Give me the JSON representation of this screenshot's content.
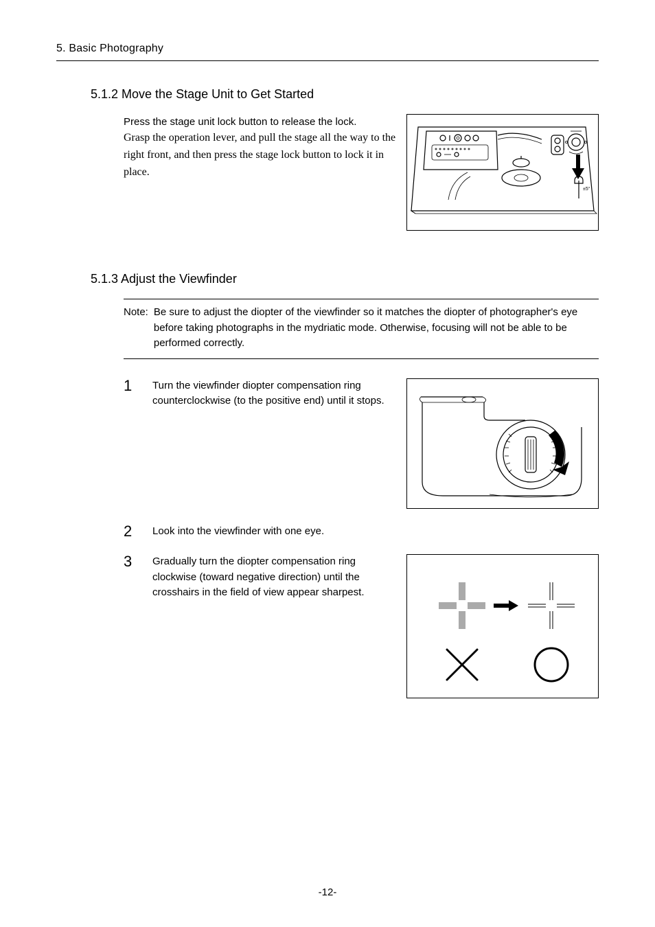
{
  "chapter": "5. Basic Photography",
  "section_512": {
    "heading": "5.1.2 Move the Stage Unit to Get Started",
    "p1": "Press the stage unit lock button to release the lock.",
    "p2_serif": "Grasp the operation lever, and pull the stage all the way to the right front, and then press the stage lock button to lock it in place."
  },
  "section_513": {
    "heading": "5.1.3 Adjust the Viewfinder",
    "note_label": "Note:",
    "note_text": "Be sure to adjust the diopter of the viewfinder so it matches the diopter of photographer's eye before taking photographs in the mydriatic mode. Otherwise, focusing will not be able to be performed correctly.",
    "steps": [
      {
        "num": "1",
        "text": "Turn the viewfinder diopter compensation ring counterclockwise (to the positive end) until it stops."
      },
      {
        "num": "2",
        "text": "Look into the viewfinder with one eye."
      },
      {
        "num": "3",
        "text": "Gradually turn the diopter compensation ring clockwise (toward negative direction) until the crosshairs in the field of view appear sharpest."
      }
    ]
  },
  "page_number": "-12-"
}
